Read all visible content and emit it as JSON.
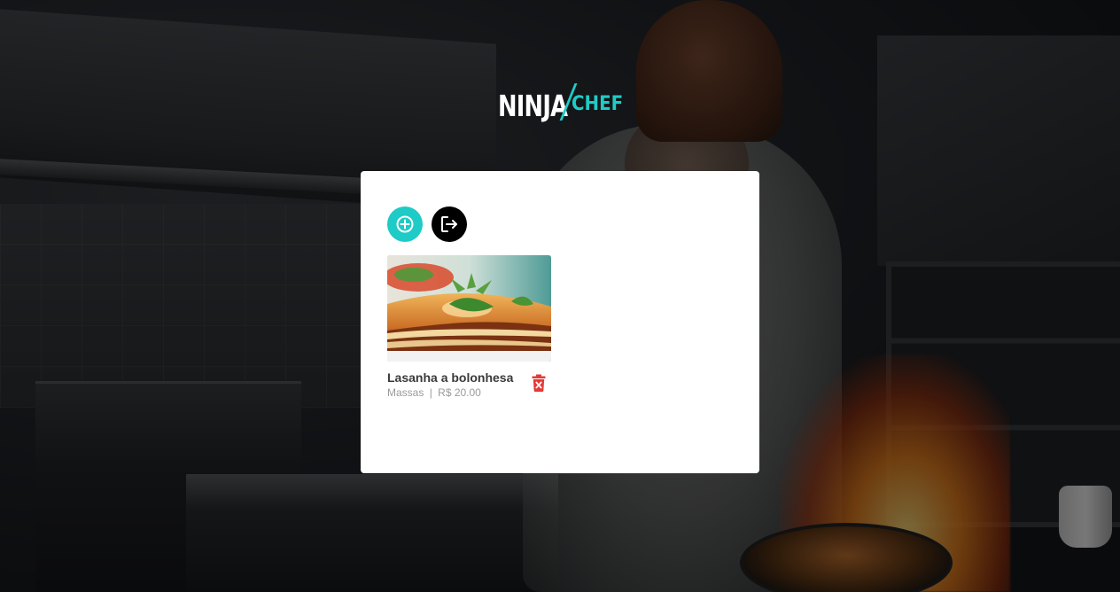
{
  "logo": {
    "part1": "NINJA",
    "part2": "CHEF",
    "accent_color": "#1ecbc6"
  },
  "toolbar": {
    "add_icon": "plus-circle-icon",
    "logout_icon": "logout-icon"
  },
  "dishes": [
    {
      "name": "Lasanha a bolonhesa",
      "category": "Massas",
      "separator": "|",
      "price": "R$ 20.00",
      "delete_icon": "trash-icon",
      "delete_color": "#e53935"
    }
  ]
}
